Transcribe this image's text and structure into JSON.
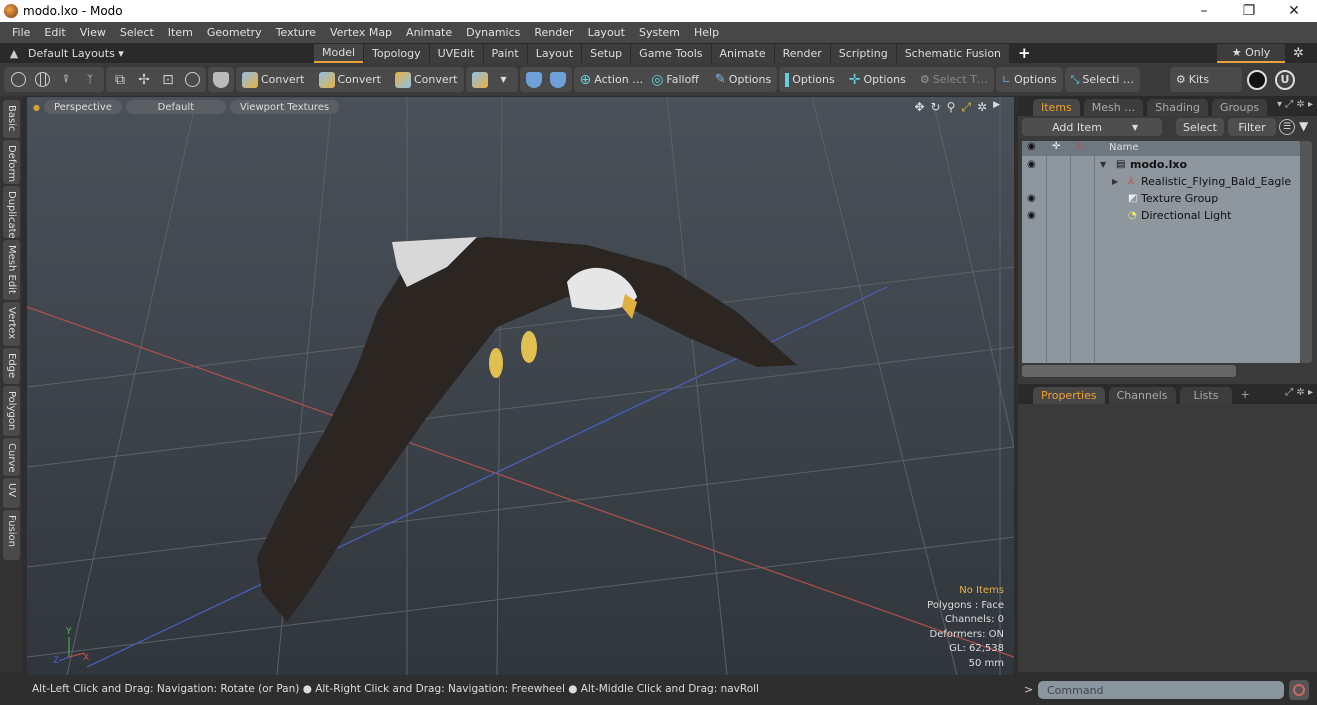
{
  "window": {
    "title": "modo.lxo - Modo",
    "minimize": "–",
    "restore": "❐",
    "close": "✕"
  },
  "menu": [
    "File",
    "Edit",
    "View",
    "Select",
    "Item",
    "Geometry",
    "Texture",
    "Vertex Map",
    "Animate",
    "Dynamics",
    "Render",
    "Layout",
    "System",
    "Help"
  ],
  "layoutbar": {
    "layouts_label": "Default Layouts ▾",
    "tabs": [
      "Model",
      "Topology",
      "UVEdit",
      "Paint",
      "Layout",
      "Setup",
      "Game Tools",
      "Animate",
      "Render",
      "Scripting",
      "Schematic Fusion"
    ],
    "active_tab": "Model",
    "add": "+",
    "only_label": "★ Only"
  },
  "toolbar": {
    "convert1": "Convert",
    "convert2": "Convert",
    "convert3": "Convert",
    "action": "Action …",
    "falloff": "Falloff",
    "options1": "Options",
    "options2": "Options",
    "options3": "Options",
    "select_t": "Select T…",
    "options4": "Options",
    "selecti": "Selecti …",
    "kits": "Kits"
  },
  "left_tabs": [
    "Basic",
    "Deform",
    "Duplicate",
    "Mesh Edit",
    "Vertex",
    "Edge",
    "Polygon",
    "Curve",
    "UV",
    "Fusion"
  ],
  "viewport": {
    "view": "Perspective",
    "shading": "Default",
    "textures": "Viewport Textures",
    "info": {
      "selection": "No Items",
      "polygons": "Polygons : Face",
      "channels": "Channels: 0",
      "deformers": "Deformers: ON",
      "gl": "GL: 62,538",
      "scale": "50 mm"
    },
    "axis_labels": {
      "x": "X",
      "y": "Y",
      "z": "Z"
    }
  },
  "items_panel": {
    "tabs": [
      "Items",
      "Mesh …",
      "Shading",
      "Groups"
    ],
    "active_tab": "Items",
    "add_item": "Add Item",
    "select": "Select",
    "filter": "Filter",
    "col_name": "Name",
    "items": [
      {
        "name": "modo.lxo",
        "level": 0,
        "visible": true,
        "bold": true
      },
      {
        "name": "Realistic_Flying_Bald_Eagle",
        "level": 1,
        "visible": false
      },
      {
        "name": "Texture Group",
        "level": 1,
        "visible": true
      },
      {
        "name": "Directional Light",
        "level": 1,
        "visible": true
      }
    ]
  },
  "properties_panel": {
    "tabs": [
      "Properties",
      "Channels",
      "Lists"
    ],
    "active_tab": "Properties",
    "add": "+"
  },
  "statusbar": {
    "hint": "Alt-Left Click and Drag: Navigation: Rotate (or Pan) ● Alt-Right Click and Drag: Navigation: Freewheel ● Alt-Middle Click and Drag: navRoll",
    "command_placeholder": "Command",
    "prompt": ">"
  },
  "colors": {
    "accent": "#e8a23a",
    "active_tab_text": "#f0a030"
  }
}
